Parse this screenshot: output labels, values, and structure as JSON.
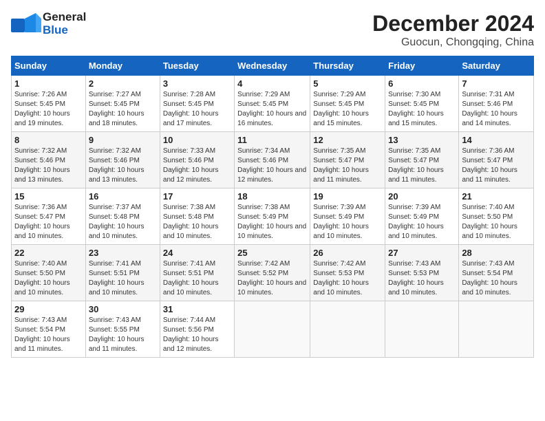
{
  "header": {
    "logo_general": "General",
    "logo_blue": "Blue",
    "month_title": "December 2024",
    "location": "Guocun, Chongqing, China"
  },
  "weekdays": [
    "Sunday",
    "Monday",
    "Tuesday",
    "Wednesday",
    "Thursday",
    "Friday",
    "Saturday"
  ],
  "weeks": [
    [
      {
        "day": "1",
        "sunrise": "7:26 AM",
        "sunset": "5:45 PM",
        "daylight": "10 hours and 19 minutes."
      },
      {
        "day": "2",
        "sunrise": "7:27 AM",
        "sunset": "5:45 PM",
        "daylight": "10 hours and 18 minutes."
      },
      {
        "day": "3",
        "sunrise": "7:28 AM",
        "sunset": "5:45 PM",
        "daylight": "10 hours and 17 minutes."
      },
      {
        "day": "4",
        "sunrise": "7:29 AM",
        "sunset": "5:45 PM",
        "daylight": "10 hours and 16 minutes."
      },
      {
        "day": "5",
        "sunrise": "7:29 AM",
        "sunset": "5:45 PM",
        "daylight": "10 hours and 15 minutes."
      },
      {
        "day": "6",
        "sunrise": "7:30 AM",
        "sunset": "5:45 PM",
        "daylight": "10 hours and 15 minutes."
      },
      {
        "day": "7",
        "sunrise": "7:31 AM",
        "sunset": "5:46 PM",
        "daylight": "10 hours and 14 minutes."
      }
    ],
    [
      {
        "day": "8",
        "sunrise": "7:32 AM",
        "sunset": "5:46 PM",
        "daylight": "10 hours and 13 minutes."
      },
      {
        "day": "9",
        "sunrise": "7:32 AM",
        "sunset": "5:46 PM",
        "daylight": "10 hours and 13 minutes."
      },
      {
        "day": "10",
        "sunrise": "7:33 AM",
        "sunset": "5:46 PM",
        "daylight": "10 hours and 12 minutes."
      },
      {
        "day": "11",
        "sunrise": "7:34 AM",
        "sunset": "5:46 PM",
        "daylight": "10 hours and 12 minutes."
      },
      {
        "day": "12",
        "sunrise": "7:35 AM",
        "sunset": "5:47 PM",
        "daylight": "10 hours and 11 minutes."
      },
      {
        "day": "13",
        "sunrise": "7:35 AM",
        "sunset": "5:47 PM",
        "daylight": "10 hours and 11 minutes."
      },
      {
        "day": "14",
        "sunrise": "7:36 AM",
        "sunset": "5:47 PM",
        "daylight": "10 hours and 11 minutes."
      }
    ],
    [
      {
        "day": "15",
        "sunrise": "7:36 AM",
        "sunset": "5:47 PM",
        "daylight": "10 hours and 10 minutes."
      },
      {
        "day": "16",
        "sunrise": "7:37 AM",
        "sunset": "5:48 PM",
        "daylight": "10 hours and 10 minutes."
      },
      {
        "day": "17",
        "sunrise": "7:38 AM",
        "sunset": "5:48 PM",
        "daylight": "10 hours and 10 minutes."
      },
      {
        "day": "18",
        "sunrise": "7:38 AM",
        "sunset": "5:49 PM",
        "daylight": "10 hours and 10 minutes."
      },
      {
        "day": "19",
        "sunrise": "7:39 AM",
        "sunset": "5:49 PM",
        "daylight": "10 hours and 10 minutes."
      },
      {
        "day": "20",
        "sunrise": "7:39 AM",
        "sunset": "5:49 PM",
        "daylight": "10 hours and 10 minutes."
      },
      {
        "day": "21",
        "sunrise": "7:40 AM",
        "sunset": "5:50 PM",
        "daylight": "10 hours and 10 minutes."
      }
    ],
    [
      {
        "day": "22",
        "sunrise": "7:40 AM",
        "sunset": "5:50 PM",
        "daylight": "10 hours and 10 minutes."
      },
      {
        "day": "23",
        "sunrise": "7:41 AM",
        "sunset": "5:51 PM",
        "daylight": "10 hours and 10 minutes."
      },
      {
        "day": "24",
        "sunrise": "7:41 AM",
        "sunset": "5:51 PM",
        "daylight": "10 hours and 10 minutes."
      },
      {
        "day": "25",
        "sunrise": "7:42 AM",
        "sunset": "5:52 PM",
        "daylight": "10 hours and 10 minutes."
      },
      {
        "day": "26",
        "sunrise": "7:42 AM",
        "sunset": "5:53 PM",
        "daylight": "10 hours and 10 minutes."
      },
      {
        "day": "27",
        "sunrise": "7:43 AM",
        "sunset": "5:53 PM",
        "daylight": "10 hours and 10 minutes."
      },
      {
        "day": "28",
        "sunrise": "7:43 AM",
        "sunset": "5:54 PM",
        "daylight": "10 hours and 10 minutes."
      }
    ],
    [
      {
        "day": "29",
        "sunrise": "7:43 AM",
        "sunset": "5:54 PM",
        "daylight": "10 hours and 11 minutes."
      },
      {
        "day": "30",
        "sunrise": "7:43 AM",
        "sunset": "5:55 PM",
        "daylight": "10 hours and 11 minutes."
      },
      {
        "day": "31",
        "sunrise": "7:44 AM",
        "sunset": "5:56 PM",
        "daylight": "10 hours and 12 minutes."
      },
      null,
      null,
      null,
      null
    ]
  ]
}
